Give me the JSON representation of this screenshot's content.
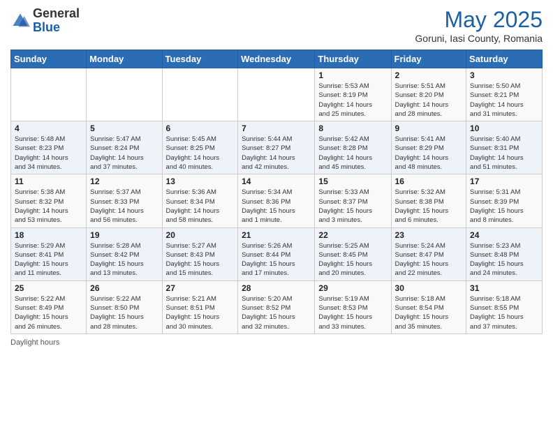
{
  "header": {
    "logo_general": "General",
    "logo_blue": "Blue",
    "month_year": "May 2025",
    "location": "Goruni, Iasi County, Romania"
  },
  "days_of_week": [
    "Sunday",
    "Monday",
    "Tuesday",
    "Wednesday",
    "Thursday",
    "Friday",
    "Saturday"
  ],
  "weeks": [
    [
      {
        "day": "",
        "info": ""
      },
      {
        "day": "",
        "info": ""
      },
      {
        "day": "",
        "info": ""
      },
      {
        "day": "",
        "info": ""
      },
      {
        "day": "1",
        "info": "Sunrise: 5:53 AM\nSunset: 8:19 PM\nDaylight: 14 hours\nand 25 minutes."
      },
      {
        "day": "2",
        "info": "Sunrise: 5:51 AM\nSunset: 8:20 PM\nDaylight: 14 hours\nand 28 minutes."
      },
      {
        "day": "3",
        "info": "Sunrise: 5:50 AM\nSunset: 8:21 PM\nDaylight: 14 hours\nand 31 minutes."
      }
    ],
    [
      {
        "day": "4",
        "info": "Sunrise: 5:48 AM\nSunset: 8:23 PM\nDaylight: 14 hours\nand 34 minutes."
      },
      {
        "day": "5",
        "info": "Sunrise: 5:47 AM\nSunset: 8:24 PM\nDaylight: 14 hours\nand 37 minutes."
      },
      {
        "day": "6",
        "info": "Sunrise: 5:45 AM\nSunset: 8:25 PM\nDaylight: 14 hours\nand 40 minutes."
      },
      {
        "day": "7",
        "info": "Sunrise: 5:44 AM\nSunset: 8:27 PM\nDaylight: 14 hours\nand 42 minutes."
      },
      {
        "day": "8",
        "info": "Sunrise: 5:42 AM\nSunset: 8:28 PM\nDaylight: 14 hours\nand 45 minutes."
      },
      {
        "day": "9",
        "info": "Sunrise: 5:41 AM\nSunset: 8:29 PM\nDaylight: 14 hours\nand 48 minutes."
      },
      {
        "day": "10",
        "info": "Sunrise: 5:40 AM\nSunset: 8:31 PM\nDaylight: 14 hours\nand 51 minutes."
      }
    ],
    [
      {
        "day": "11",
        "info": "Sunrise: 5:38 AM\nSunset: 8:32 PM\nDaylight: 14 hours\nand 53 minutes."
      },
      {
        "day": "12",
        "info": "Sunrise: 5:37 AM\nSunset: 8:33 PM\nDaylight: 14 hours\nand 56 minutes."
      },
      {
        "day": "13",
        "info": "Sunrise: 5:36 AM\nSunset: 8:34 PM\nDaylight: 14 hours\nand 58 minutes."
      },
      {
        "day": "14",
        "info": "Sunrise: 5:34 AM\nSunset: 8:36 PM\nDaylight: 15 hours\nand 1 minute."
      },
      {
        "day": "15",
        "info": "Sunrise: 5:33 AM\nSunset: 8:37 PM\nDaylight: 15 hours\nand 3 minutes."
      },
      {
        "day": "16",
        "info": "Sunrise: 5:32 AM\nSunset: 8:38 PM\nDaylight: 15 hours\nand 6 minutes."
      },
      {
        "day": "17",
        "info": "Sunrise: 5:31 AM\nSunset: 8:39 PM\nDaylight: 15 hours\nand 8 minutes."
      }
    ],
    [
      {
        "day": "18",
        "info": "Sunrise: 5:29 AM\nSunset: 8:41 PM\nDaylight: 15 hours\nand 11 minutes."
      },
      {
        "day": "19",
        "info": "Sunrise: 5:28 AM\nSunset: 8:42 PM\nDaylight: 15 hours\nand 13 minutes."
      },
      {
        "day": "20",
        "info": "Sunrise: 5:27 AM\nSunset: 8:43 PM\nDaylight: 15 hours\nand 15 minutes."
      },
      {
        "day": "21",
        "info": "Sunrise: 5:26 AM\nSunset: 8:44 PM\nDaylight: 15 hours\nand 17 minutes."
      },
      {
        "day": "22",
        "info": "Sunrise: 5:25 AM\nSunset: 8:45 PM\nDaylight: 15 hours\nand 20 minutes."
      },
      {
        "day": "23",
        "info": "Sunrise: 5:24 AM\nSunset: 8:47 PM\nDaylight: 15 hours\nand 22 minutes."
      },
      {
        "day": "24",
        "info": "Sunrise: 5:23 AM\nSunset: 8:48 PM\nDaylight: 15 hours\nand 24 minutes."
      }
    ],
    [
      {
        "day": "25",
        "info": "Sunrise: 5:22 AM\nSunset: 8:49 PM\nDaylight: 15 hours\nand 26 minutes."
      },
      {
        "day": "26",
        "info": "Sunrise: 5:22 AM\nSunset: 8:50 PM\nDaylight: 15 hours\nand 28 minutes."
      },
      {
        "day": "27",
        "info": "Sunrise: 5:21 AM\nSunset: 8:51 PM\nDaylight: 15 hours\nand 30 minutes."
      },
      {
        "day": "28",
        "info": "Sunrise: 5:20 AM\nSunset: 8:52 PM\nDaylight: 15 hours\nand 32 minutes."
      },
      {
        "day": "29",
        "info": "Sunrise: 5:19 AM\nSunset: 8:53 PM\nDaylight: 15 hours\nand 33 minutes."
      },
      {
        "day": "30",
        "info": "Sunrise: 5:18 AM\nSunset: 8:54 PM\nDaylight: 15 hours\nand 35 minutes."
      },
      {
        "day": "31",
        "info": "Sunrise: 5:18 AM\nSunset: 8:55 PM\nDaylight: 15 hours\nand 37 minutes."
      }
    ]
  ],
  "footer": {
    "daylight_label": "Daylight hours"
  }
}
